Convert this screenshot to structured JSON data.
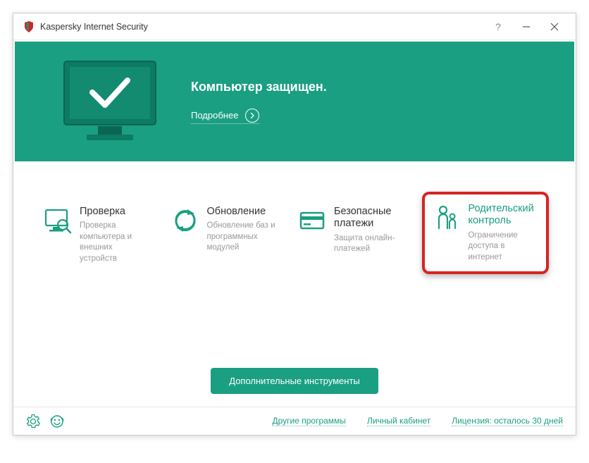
{
  "app": {
    "title": "Kaspersky Internet Security"
  },
  "banner": {
    "status": "Компьютер защищен.",
    "details_label": "Подробнее"
  },
  "tiles": {
    "scan": {
      "title": "Проверка",
      "desc": "Проверка компьютера и внешних устройств"
    },
    "update": {
      "title": "Обновление",
      "desc": "Обновление баз и программных модулей"
    },
    "safemoney": {
      "title": "Безопасные платежи",
      "desc": "Защита онлайн-платежей"
    },
    "parental": {
      "title": "Родительский контроль",
      "desc": "Ограничение доступа в интернет"
    }
  },
  "more_tools": "Дополнительные инструменты",
  "footer": {
    "other_programs": "Другие программы",
    "cabinet": "Личный кабинет",
    "license": "Лицензия: осталось 30 дней"
  }
}
